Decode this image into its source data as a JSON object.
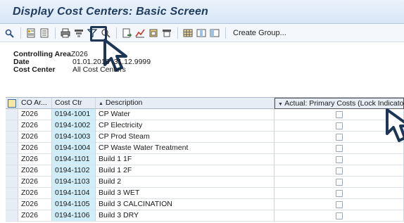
{
  "window": {
    "title": "Display Cost Centers: Basic Screen"
  },
  "toolbar": {
    "icons": [
      "glasses-icon",
      "detail-icon",
      "choose-icon",
      "print-icon",
      "sort-icon",
      "filter-icon",
      "find-icon",
      "export-icon",
      "chart-icon",
      "refresh-icon",
      "layout-icon",
      "grid-icon",
      "columns-icon",
      "group-icon"
    ],
    "create_group_label": "Create Group..."
  },
  "selection": {
    "controlling_area_label": "Controlling Area",
    "controlling_area_value": "Z026",
    "date_label": "Date",
    "date_from": "01.01.2016",
    "date_to": "31.12.9999",
    "cost_center_label": "Cost Center",
    "cost_center_value": "All Cost Centers"
  },
  "table": {
    "headers": {
      "co_area": "CO Ar...",
      "cost_ctr": "Cost Ctr",
      "description": "Description",
      "actual": "Actual: Primary Costs (Lock Indicator)"
    },
    "rows": [
      {
        "co_area": "Z026",
        "cost_ctr": "0194-1001",
        "description": "CP Water"
      },
      {
        "co_area": "Z026",
        "cost_ctr": "0194-1002",
        "description": "CP Electricity"
      },
      {
        "co_area": "Z026",
        "cost_ctr": "0194-1003",
        "description": "CP Prod Steam"
      },
      {
        "co_area": "Z026",
        "cost_ctr": "0194-1004",
        "description": "CP Waste Water Treatment"
      },
      {
        "co_area": "Z026",
        "cost_ctr": "0194-1101",
        "description": "Build 1 1F"
      },
      {
        "co_area": "Z026",
        "cost_ctr": "0194-1102",
        "description": "Build 1 2F"
      },
      {
        "co_area": "Z026",
        "cost_ctr": "0194-1103",
        "description": "Build 2"
      },
      {
        "co_area": "Z026",
        "cost_ctr": "0194-1104",
        "description": "Build 3 WET"
      },
      {
        "co_area": "Z026",
        "cost_ctr": "0194-1105",
        "description": "Build 3 CALCINATION"
      },
      {
        "co_area": "Z026",
        "cost_ctr": "0194-1106",
        "description": "Build 3 DRY"
      }
    ]
  },
  "colors": {
    "accent": "#1d3656",
    "cost_ctr_bg": "#cfeefa",
    "title": "#1f3b5e"
  }
}
